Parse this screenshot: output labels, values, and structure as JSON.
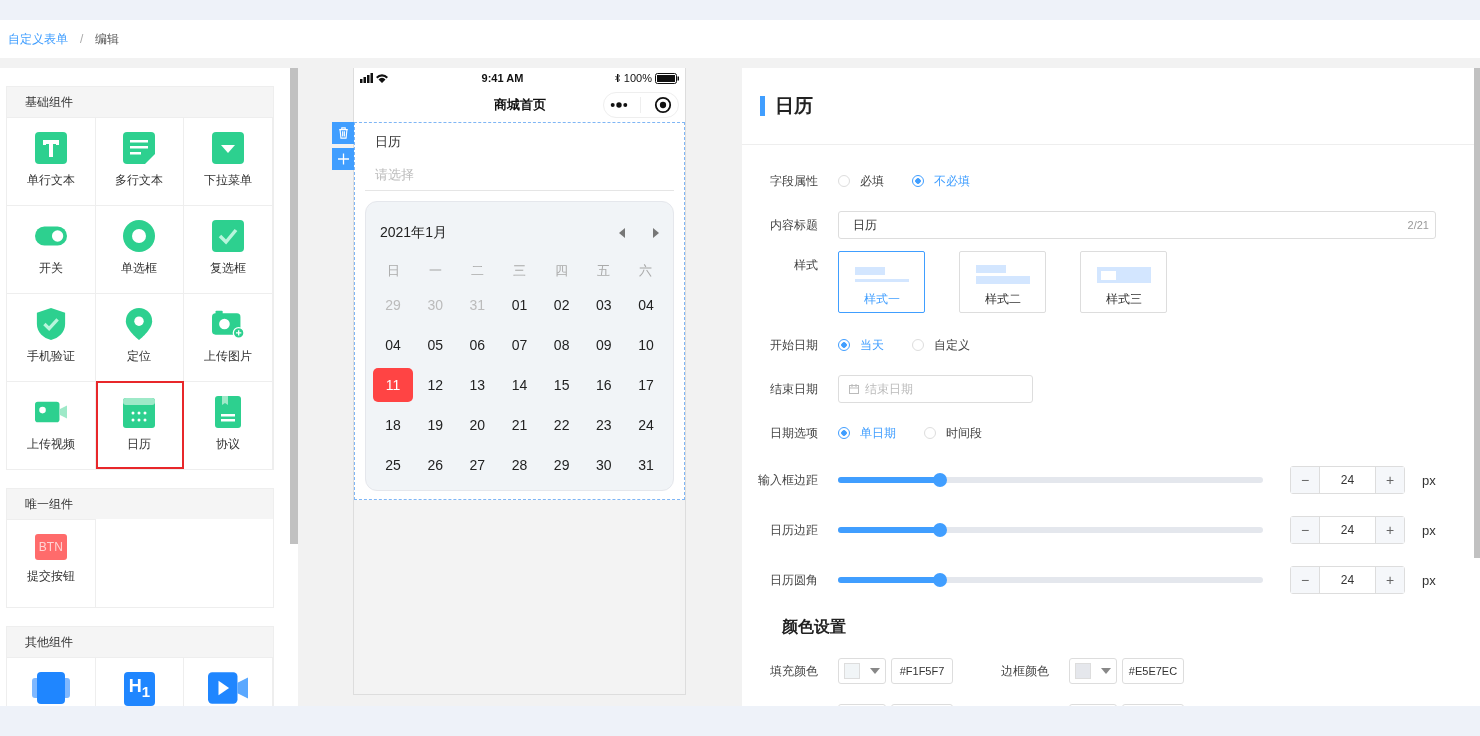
{
  "breadcrumb": {
    "separator": "/",
    "items": [
      {
        "label": "自定义表单",
        "current": false
      },
      {
        "label": "编辑",
        "current": true
      }
    ]
  },
  "palette": [
    {
      "title": "基础组件",
      "items": [
        {
          "label": "单行文本",
          "selected": false
        },
        {
          "label": "多行文本",
          "selected": false
        },
        {
          "label": "下拉菜单",
          "selected": false
        },
        {
          "label": "开关",
          "selected": false
        },
        {
          "label": "单选框",
          "selected": false
        },
        {
          "label": "复选框",
          "selected": false
        },
        {
          "label": "手机验证",
          "selected": false
        },
        {
          "label": "定位",
          "selected": false
        },
        {
          "label": "上传图片",
          "selected": false
        },
        {
          "label": "上传视频",
          "selected": false
        },
        {
          "label": "日历",
          "selected": true
        },
        {
          "label": "协议",
          "selected": false
        }
      ]
    },
    {
      "title": "唯一组件",
      "items": [
        {
          "label": "提交按钮",
          "icon_text": "BTN",
          "selected": false
        }
      ]
    },
    {
      "title": "其他组件",
      "items": [
        {
          "selected": false
        },
        {
          "icon_text": "H$_{1}$",
          "selected": false
        },
        {
          "selected": false
        }
      ]
    }
  ],
  "phone": {
    "time": "9:41 AM",
    "battery": "100%",
    "nav_title": "商城首页",
    "field_label": "日历",
    "placeholder": "请选择",
    "calendar": {
      "month": "2021年1月",
      "weekdays": [
        "日",
        "一",
        "二",
        "三",
        "四",
        "五",
        "六"
      ],
      "days": [
        {
          "day": "29",
          "muted": true,
          "selected": false
        },
        {
          "day": "30",
          "muted": true,
          "selected": false
        },
        {
          "day": "31",
          "muted": true,
          "selected": false
        },
        {
          "day": "01",
          "muted": false,
          "selected": false
        },
        {
          "day": "02",
          "muted": false,
          "selected": false
        },
        {
          "day": "03",
          "muted": false,
          "selected": false
        },
        {
          "day": "04",
          "muted": false,
          "selected": false
        },
        {
          "day": "04",
          "muted": false,
          "selected": false
        },
        {
          "day": "05",
          "muted": false,
          "selected": false
        },
        {
          "day": "06",
          "muted": false,
          "selected": false
        },
        {
          "day": "07",
          "muted": false,
          "selected": false
        },
        {
          "day": "08",
          "muted": false,
          "selected": false
        },
        {
          "day": "09",
          "muted": false,
          "selected": false
        },
        {
          "day": "10",
          "muted": false,
          "selected": false
        },
        {
          "day": "11",
          "muted": false,
          "selected": true
        },
        {
          "day": "12",
          "muted": false,
          "selected": false
        },
        {
          "day": "13",
          "muted": false,
          "selected": false
        },
        {
          "day": "14",
          "muted": false,
          "selected": false
        },
        {
          "day": "15",
          "muted": false,
          "selected": false
        },
        {
          "day": "16",
          "muted": false,
          "selected": false
        },
        {
          "day": "17",
          "muted": false,
          "selected": false
        },
        {
          "day": "18",
          "muted": false,
          "selected": false
        },
        {
          "day": "19",
          "muted": false,
          "selected": false
        },
        {
          "day": "20",
          "muted": false,
          "selected": false
        },
        {
          "day": "21",
          "muted": false,
          "selected": false
        },
        {
          "day": "22",
          "muted": false,
          "selected": false
        },
        {
          "day": "23",
          "muted": false,
          "selected": false
        },
        {
          "day": "24",
          "muted": false,
          "selected": false
        },
        {
          "day": "25",
          "muted": false,
          "selected": false
        },
        {
          "day": "26",
          "muted": false,
          "selected": false
        },
        {
          "day": "27",
          "muted": false,
          "selected": false
        },
        {
          "day": "28",
          "muted": false,
          "selected": false
        },
        {
          "day": "29",
          "muted": false,
          "selected": false
        },
        {
          "day": "30",
          "muted": false,
          "selected": false
        },
        {
          "day": "31",
          "muted": false,
          "selected": false
        }
      ]
    }
  },
  "settings": {
    "title": "日历",
    "rows": [
      {
        "kind": "radio",
        "label": "字段属性",
        "options": [
          {
            "label": "必填",
            "selected": false
          },
          {
            "label": "不必填",
            "selected": true
          }
        ]
      },
      {
        "kind": "text",
        "label": "内容标题",
        "value": "日历",
        "counter": "2/21"
      },
      {
        "kind": "styles",
        "label": "样式",
        "options": [
          {
            "label": "样式一",
            "selected": true
          },
          {
            "label": "样式二",
            "selected": false
          },
          {
            "label": "样式三",
            "selected": false
          }
        ]
      },
      {
        "kind": "radio",
        "label": "开始日期",
        "options": [
          {
            "label": "当天",
            "selected": true
          },
          {
            "label": "自定义",
            "selected": false
          }
        ]
      },
      {
        "kind": "date",
        "label": "结束日期",
        "placeholder": "结束日期"
      },
      {
        "kind": "radio",
        "label": "日期选项",
        "options": [
          {
            "label": "单日期",
            "selected": true
          },
          {
            "label": "时间段",
            "selected": false
          }
        ]
      },
      {
        "kind": "slider",
        "label": "输入框边距",
        "level": 0.24,
        "value": "24",
        "minus": "−",
        "plus": "+",
        "unit": "px"
      },
      {
        "kind": "slider",
        "label": "日历边距",
        "level": 0.24,
        "value": "24",
        "minus": "−",
        "plus": "+",
        "unit": "px"
      },
      {
        "kind": "slider",
        "label": "日历圆角",
        "level": 0.24,
        "value": "24",
        "minus": "−",
        "plus": "+",
        "unit": "px"
      }
    ],
    "color_title": "颜色设置",
    "colors": [
      {
        "label": "填充颜色",
        "value": "#F1F5F7",
        "color": "#f1f5f7"
      },
      {
        "label": "边框颜色",
        "value": "#E5E7EC",
        "color": "#e5e7ec"
      }
    ]
  }
}
